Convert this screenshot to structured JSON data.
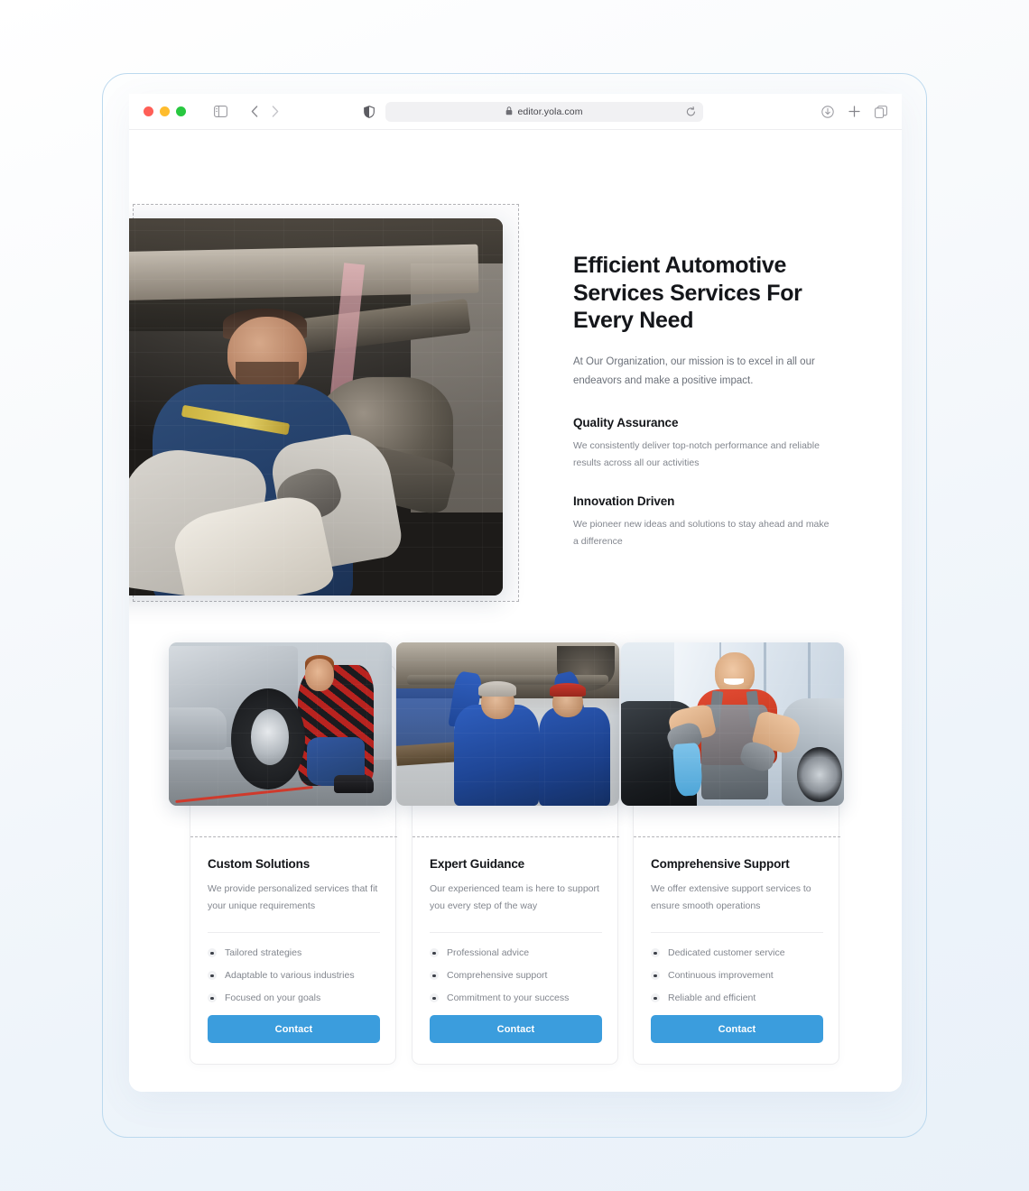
{
  "browser": {
    "url": "editor.yola.com",
    "lock_icon": "lock-icon",
    "reload_icon": "reload-icon",
    "shield_icon": "shield-icon",
    "sidebar_icon": "sidebar-toggle-icon",
    "back_icon": "chevron-left-icon",
    "forward_icon": "chevron-right-icon",
    "download_icon": "download-icon",
    "new_tab_icon": "plus-icon",
    "tab_overview_icon": "tab-overview-icon",
    "traffic_lights": {
      "close_color": "#ff5f57",
      "minimize_color": "#febc2e",
      "zoom_color": "#28c840"
    }
  },
  "theme": {
    "accent": "#3b9ddd",
    "heading": "#14161a",
    "body_text": "#82868e",
    "frame_border": "#bcd9ee",
    "dashed_border": "#b4b4b8"
  },
  "hero": {
    "title": "Efficient Automotive Services Services For Every Need",
    "subtitle": "At Our Organization, our mission is to excel in all our endeavors and make a positive impact.",
    "image_alt": "mechanic working under a vehicle in a garage",
    "features": [
      {
        "title": "Quality Assurance",
        "body": "We consistently deliver top-notch performance and reliable results across all our activities"
      },
      {
        "title": "Innovation Driven",
        "body": "We pioneer new ideas and solutions to stay ahead and make a difference"
      }
    ]
  },
  "cards": [
    {
      "image_alt": "mechanic changing a car wheel at the roadside",
      "title": "Custom Solutions",
      "description": "We provide personalized services that fit your unique requirements",
      "items": [
        "Tailored strategies",
        "Adaptable to various industries",
        "Focused on your goals"
      ],
      "button": "Contact"
    },
    {
      "image_alt": "two mechanics working beneath a lifted car",
      "title": "Expert Guidance",
      "description": "Our experienced team is here to support you every step of the way",
      "items": [
        "Professional advice",
        "Comprehensive support",
        "Commitment to your success"
      ],
      "button": "Contact"
    },
    {
      "image_alt": "smiling mechanic polishing a car in a showroom",
      "title": "Comprehensive Support",
      "description": "We offer extensive support services to ensure smooth operations",
      "items": [
        "Dedicated customer service",
        "Continuous improvement",
        "Reliable and efficient"
      ],
      "button": "Contact"
    }
  ]
}
